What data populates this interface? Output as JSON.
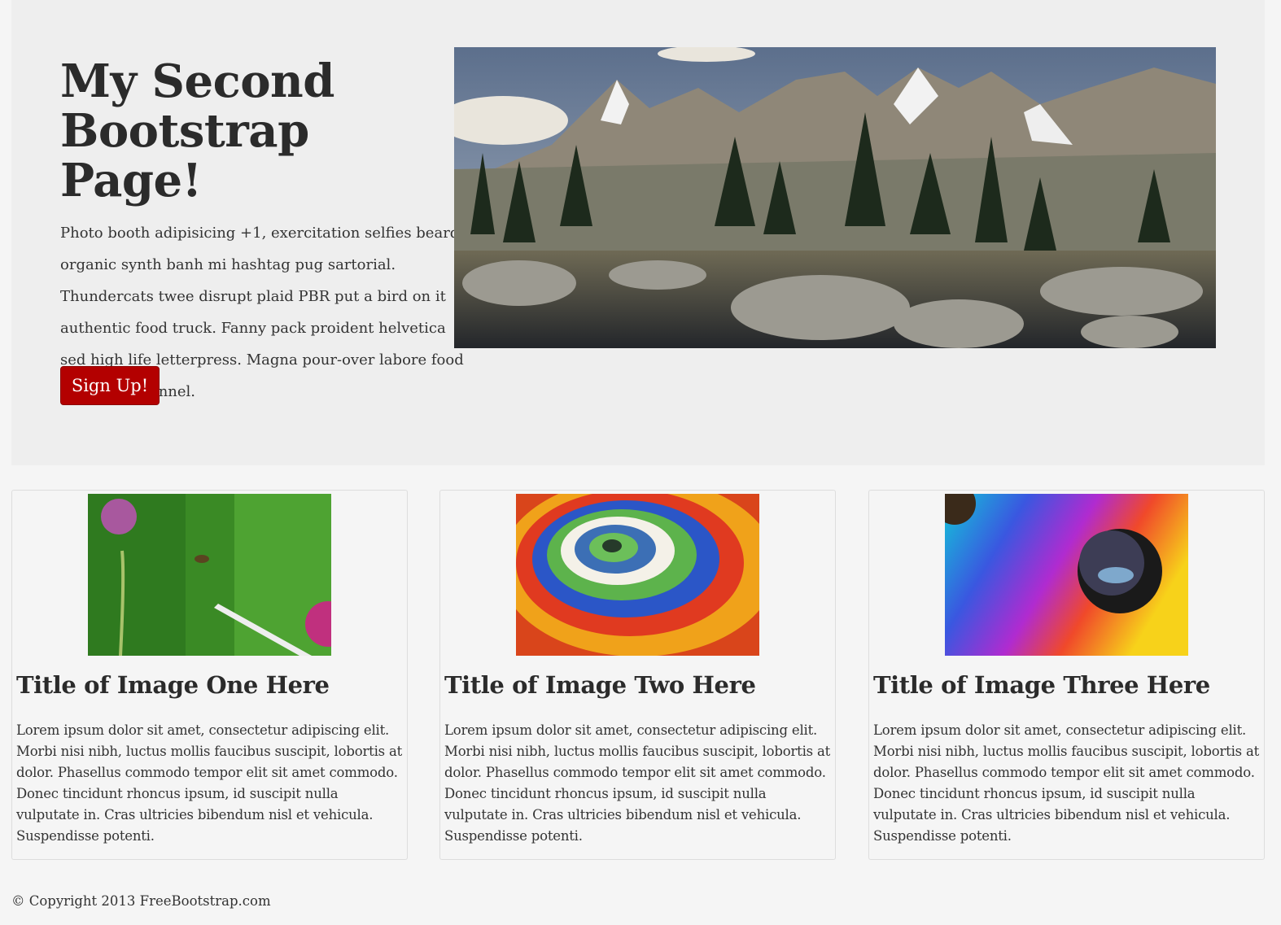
{
  "hero": {
    "title": "My Second Bootstrap Page!",
    "paragraph": "Photo booth adipisicing +1, exercitation selfies beard organic synth banh mi hashtag pug sartorial. Thundercats twee disrupt plaid PBR put a bird on it authentic food truck. Fanny pack proident helvetica sed high life letterpress. Magna pour-over labore food truck quis flannel.",
    "signup_label": "Sign Up!"
  },
  "cards": [
    {
      "title": "Title of Image One Here",
      "body": "Lorem ipsum dolor sit amet, consectetur adipiscing elit. Morbi nisi nibh, luctus mollis faucibus suscipit, lobortis at dolor. Phasellus commodo tempor elit sit amet commodo. Donec tincidunt rhoncus ipsum, id suscipit nulla vulputate in. Cras ultricies bibendum nisl et vehicula. Suspendisse potenti."
    },
    {
      "title": "Title of Image Two Here",
      "body": "Lorem ipsum dolor sit amet, consectetur adipiscing elit. Morbi nisi nibh, luctus mollis faucibus suscipit, lobortis at dolor. Phasellus commodo tempor elit sit amet commodo. Donec tincidunt rhoncus ipsum, id suscipit nulla vulputate in. Cras ultricies bibendum nisl et vehicula. Suspendisse potenti."
    },
    {
      "title": "Title of Image Three Here",
      "body": "Lorem ipsum dolor sit amet, consectetur adipiscing elit. Morbi nisi nibh, luctus mollis faucibus suscipit, lobortis at dolor. Phasellus commodo tempor elit sit amet commodo. Donec tincidunt rhoncus ipsum, id suscipit nulla vulputate in. Cras ultricies bibendum nisl et vehicula. Suspendisse potenti."
    }
  ],
  "footer": {
    "copyright": "© Copyright 2013 FreeBootstrap.com"
  },
  "colors": {
    "button": "#b30000",
    "jumbotron_bg": "#eeeeee",
    "page_bg": "#f5f5f5"
  }
}
